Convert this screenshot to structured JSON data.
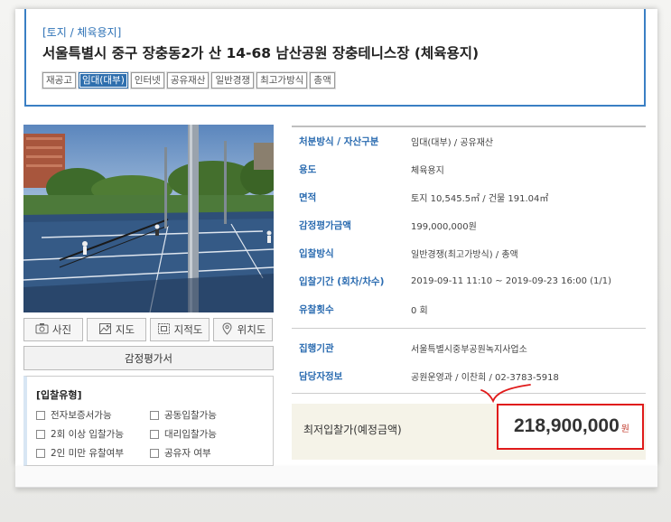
{
  "header": {
    "category": "[토지 / 체육용지]",
    "title": "서울특별시 중구 장충동2가 산 14-68 남산공원 장충테니스장 (체육용지)",
    "tags": [
      {
        "label": "재공고",
        "active": false
      },
      {
        "label": "임대(대부)",
        "active": true
      },
      {
        "label": "인터넷",
        "active": false
      },
      {
        "label": "공유재산",
        "active": false
      },
      {
        "label": "일반경쟁",
        "active": false
      },
      {
        "label": "최고가방식",
        "active": false
      },
      {
        "label": "총액",
        "active": false
      }
    ]
  },
  "photo_buttons": [
    {
      "label": "사진",
      "icon": "camera-icon"
    },
    {
      "label": "지도",
      "icon": "map-icon"
    },
    {
      "label": "지적도",
      "icon": "cadastral-map-icon"
    },
    {
      "label": "위치도",
      "icon": "location-pin-icon"
    }
  ],
  "appraisal_button": "감정평가서",
  "bid_type": {
    "title": "[입찰유형]",
    "options": [
      "전자보증서가능",
      "공동입찰가능",
      "2회 이상 입찰가능",
      "대리입찰가능",
      "2인 미만 유찰여부",
      "공유자 여부"
    ]
  },
  "info_group1": [
    {
      "label": "처분방식 / 자산구분",
      "value": "임대(대부) / 공유재산"
    },
    {
      "label": "용도",
      "value": "체육용지"
    },
    {
      "label": "면적",
      "value": "토지 10,545.5㎡ / 건물 191.04㎡"
    },
    {
      "label": "감정평가금액",
      "value": "199,000,000원"
    },
    {
      "label": "입찰방식",
      "value": "일반경쟁(최고가방식) / 총액"
    },
    {
      "label": "입찰기간 (회차/차수)",
      "value": "2019-09-11 11:10 ~ 2019-09-23 16:00 (1/1)"
    },
    {
      "label": "유찰횟수",
      "value": "0 회"
    }
  ],
  "info_group2": [
    {
      "label": "집행기관",
      "value": "서울특별시중부공원녹지사업소"
    },
    {
      "label": "담당자정보",
      "value": "공원운영과 / 이찬희 / 02-3783-5918"
    }
  ],
  "price": {
    "label": "최저입찰가(예정금액)",
    "value": "218,900,000",
    "unit": "원"
  },
  "colors": {
    "accent_blue": "#2f73b7",
    "highlight_red": "#e01b1b"
  }
}
